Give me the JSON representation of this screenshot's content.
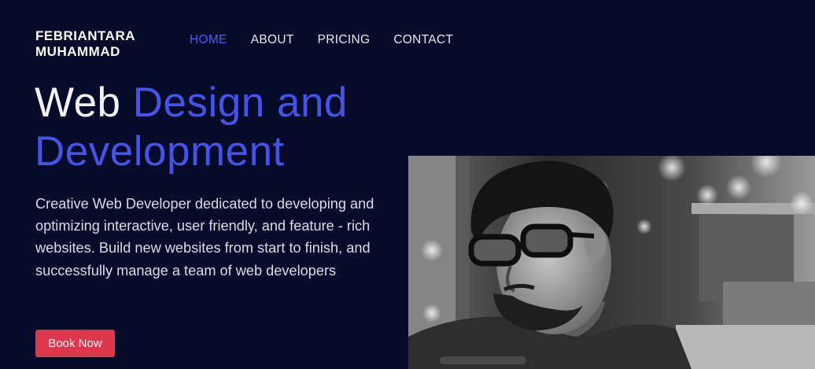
{
  "brand": {
    "line1": "FEBRIANTARA",
    "line2": "MUHAMMAD"
  },
  "nav": {
    "items": [
      {
        "label": "HOME",
        "active": true
      },
      {
        "label": "ABOUT",
        "active": false
      },
      {
        "label": "PRICING",
        "active": false
      },
      {
        "label": "CONTACT",
        "active": false
      }
    ]
  },
  "hero": {
    "title_plain": "Web",
    "title_accent": "Design and Development",
    "description": "Creative Web Developer dedicated to developing and optimizing interactive, user friendly, and feature - rich websites. Build new websites from start to finish, and successfully manage a team of web developers",
    "cta_label": "Book Now"
  },
  "colors": {
    "background": "#060b2a",
    "accent": "#4454e6",
    "nav_active": "#4a5cf2",
    "button": "#e0364c"
  }
}
